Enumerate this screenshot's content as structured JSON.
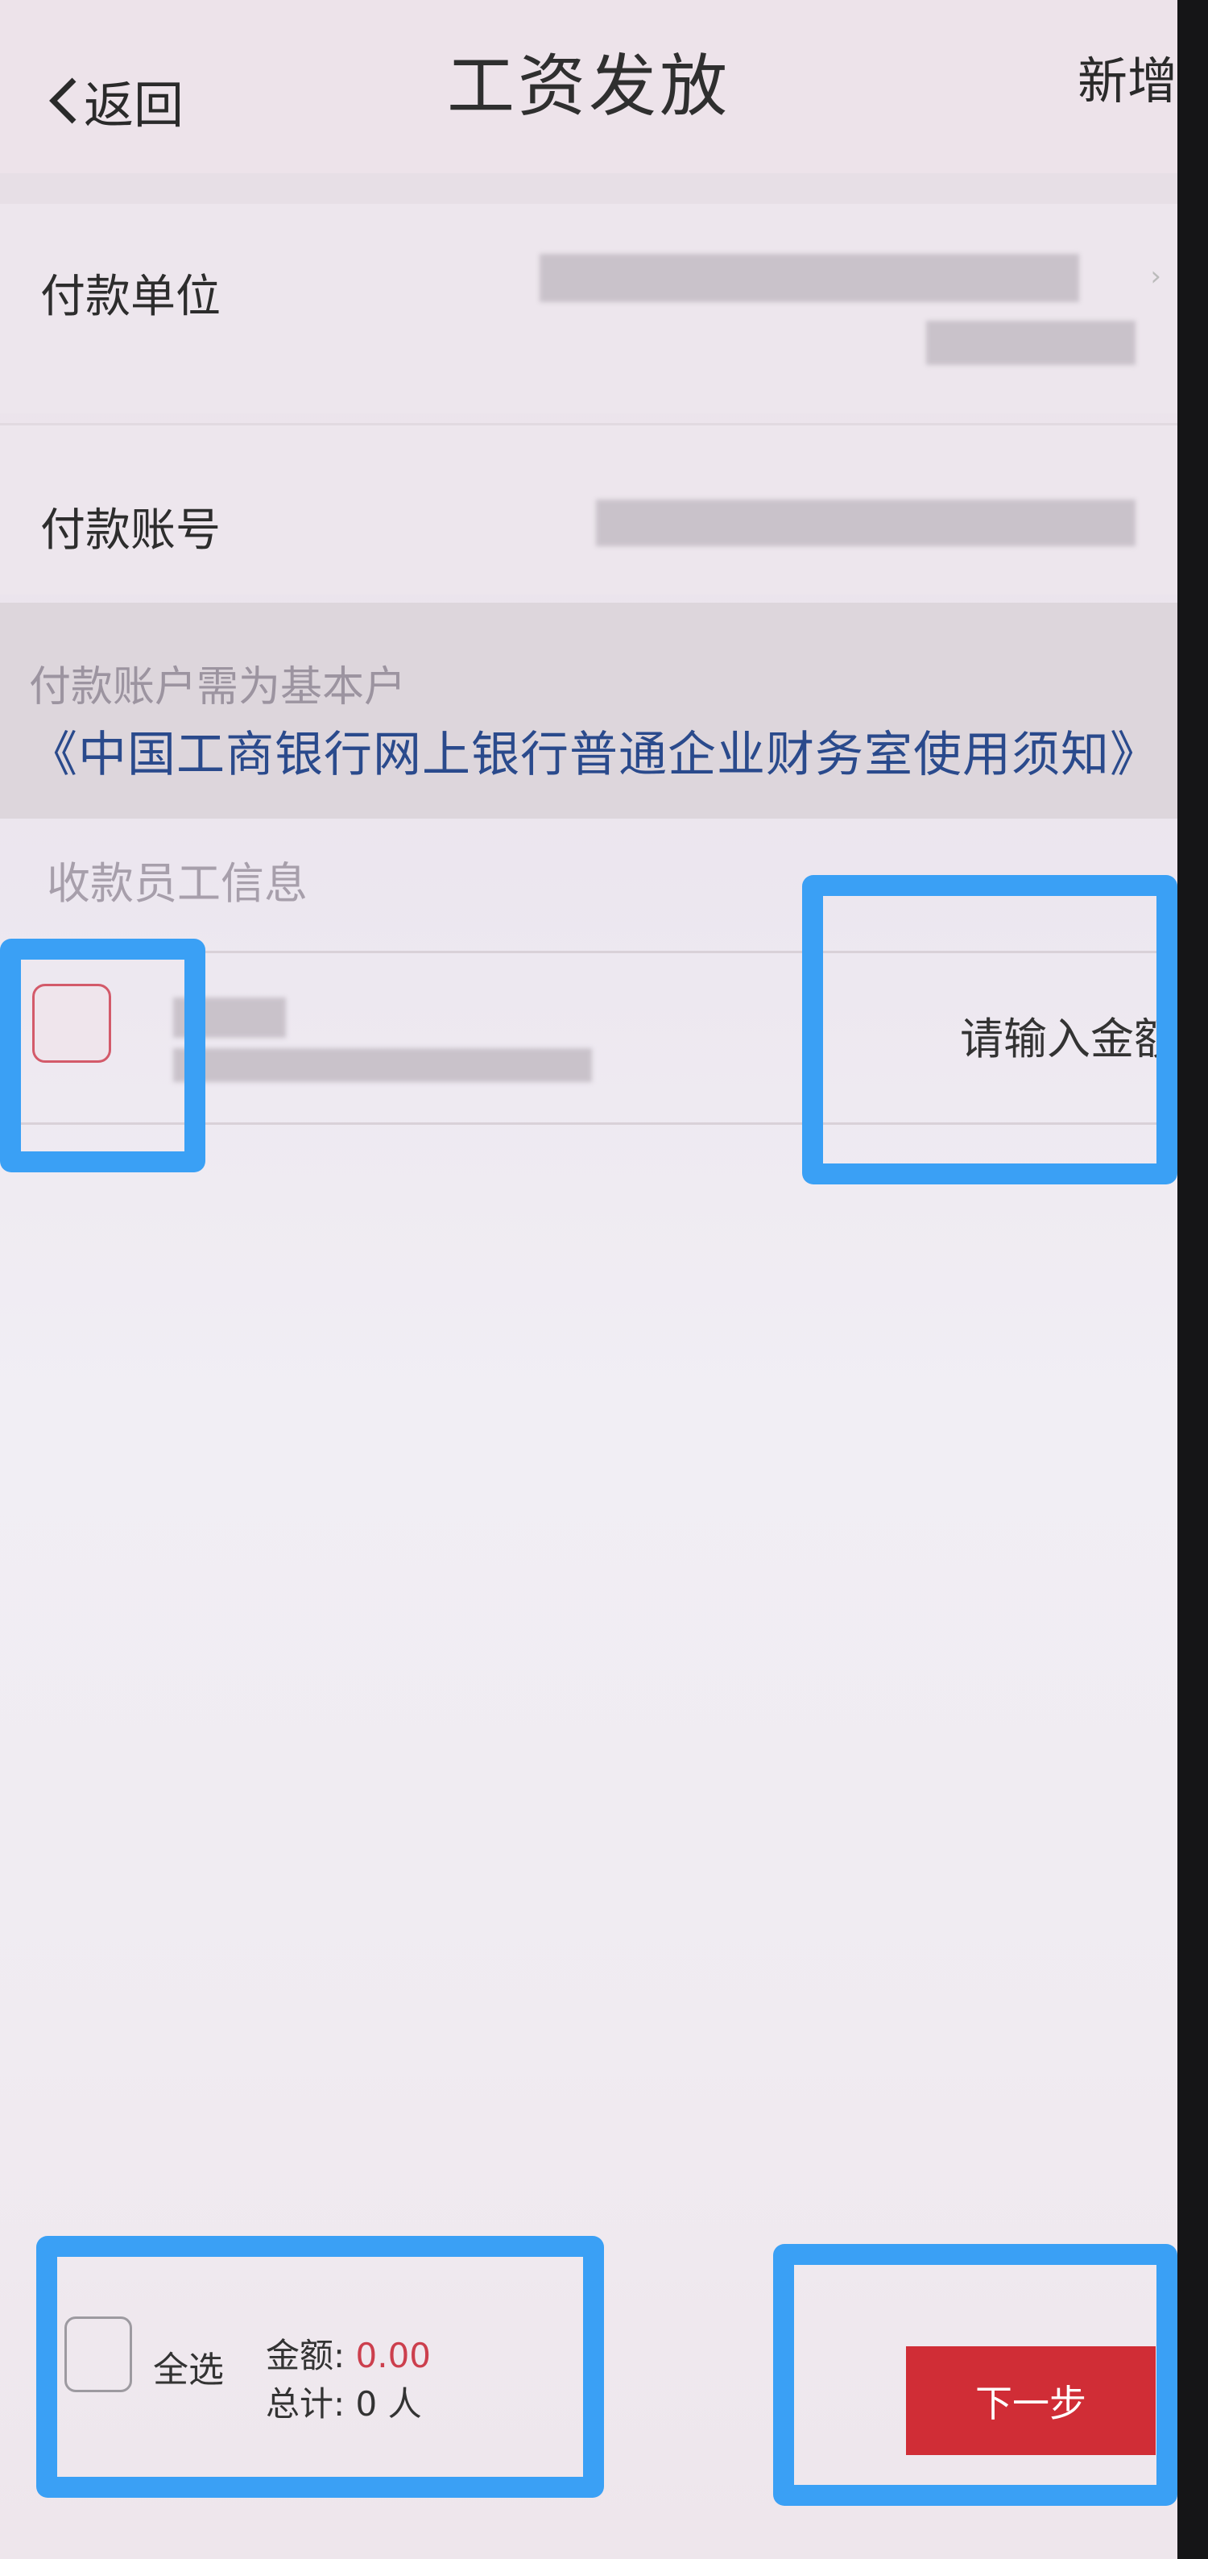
{
  "header": {
    "back_label": "返回",
    "title": "工资发放",
    "add_label": "新增"
  },
  "payer": {
    "unit_label": "付款单位",
    "account_label": "付款账号"
  },
  "notice": {
    "text": "付款账户需为基本户",
    "link": "《中国工商银行网上银行普通企业财务室使用须知》"
  },
  "employees": {
    "section_label": "收款员工信息",
    "amount_placeholder": "请输入金额"
  },
  "footer": {
    "select_all_label": "全选",
    "amount_label": "金额:",
    "amount_value": "0.00",
    "total_label": "总计:",
    "total_value": "0 人",
    "next_label": "下一步"
  },
  "colors": {
    "primary_red": "#d02d36",
    "link_blue": "#2a4a8c",
    "highlight_blue": "#3aa0f5"
  }
}
